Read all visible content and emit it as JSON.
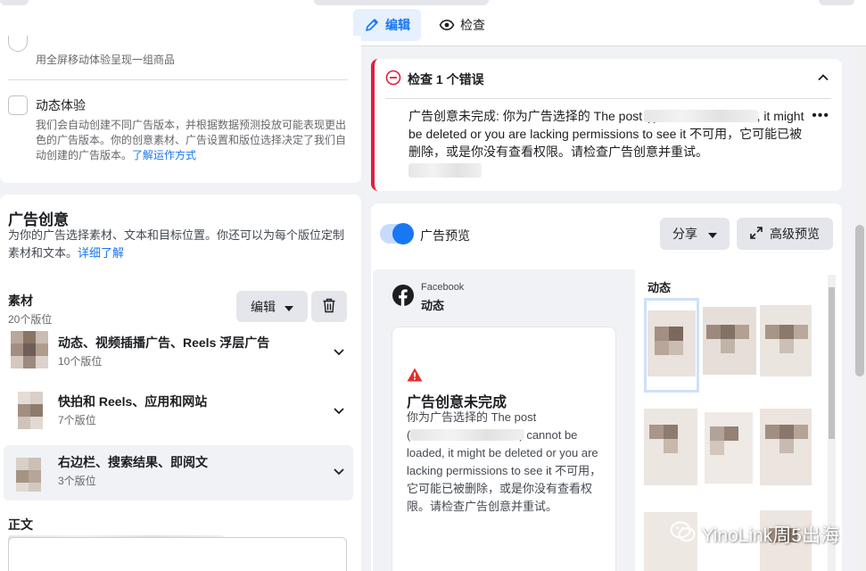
{
  "tabs": {
    "edit_label": "编辑",
    "review_label": "检查"
  },
  "options": {
    "fullscreen_desc": "用全屏移动体验呈现一组商品",
    "dynamic_title": "动态体验",
    "dynamic_desc": "我们会自动创建不同广告版本，并根据数据预测投放可能表现更出色的广告版本。你的创意素材、广告设置和版位选择决定了我们自动创建的广告版本。",
    "dynamic_link": "了解运作方式"
  },
  "creative": {
    "heading": "广告创意",
    "desc": "为你的广告选择素材、文本和目标位置。你还可以为每个版位定制素材和文本。",
    "desc_link": "详细了解",
    "media_label": "素材",
    "media_count": "20个版位",
    "edit_button": "编辑",
    "groups": [
      {
        "title": "动态、视频插播广告、Reels 浮层广告",
        "count": "10个版位"
      },
      {
        "title": "快拍和 Reels、应用和网站",
        "count": "7个版位"
      },
      {
        "title": "右边栏、搜索结果、即阅文",
        "count": "3个版位"
      }
    ],
    "body_label": "正文"
  },
  "review": {
    "title": "检查 1 个错误",
    "message": "广告创意未完成: 你为广告选择的 The post (                    ) cannot be loaded, it might be deleted or you are lacking permissions to see it 不可用，它可能已被删除，或是你没有查看权限。请检查广告创意并重试。"
  },
  "preview": {
    "toggle_label": "广告预览",
    "share_label": "分享",
    "advanced_label": "高级预览",
    "platform": "Facebook",
    "placement": "动态",
    "feed_heading": "动态",
    "error_title": "广告创意未完成",
    "error_body_1": "你为广告选择的 The post",
    "error_body_2": "cannot be loaded, it might be deleted or you are lacking permissions to see it 不可用，它可能已被删除，或是你没有查看权限。请检查广告创意并重试。"
  },
  "watermark": "YinoLink周5出海",
  "colors": {
    "brand": "#1877f2",
    "error": "#e41e3f",
    "warning": "#e4302b",
    "background": "#f0f2f5"
  }
}
